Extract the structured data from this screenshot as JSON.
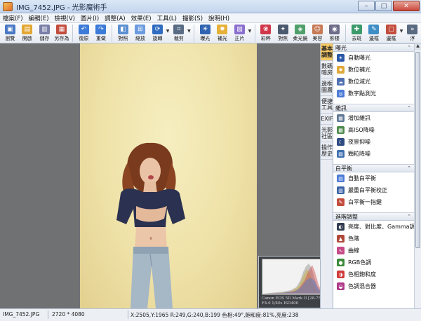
{
  "window": {
    "title": "IMG_7452.JPG - 光影魔術手",
    "min": "–",
    "max": "□",
    "close": "✕"
  },
  "menu": [
    "檔案(F)",
    "編輯(E)",
    "檢視(V)",
    "圖片(I)",
    "調整(A)",
    "效果(E)",
    "工具(L)",
    "撮影(S)",
    "說明(H)"
  ],
  "toolbar": [
    {
      "name": "browse",
      "label": "瀏覽",
      "color": "#4a79c4",
      "glyph": "▣"
    },
    {
      "name": "open",
      "label": "開啟",
      "color": "#e3a734",
      "glyph": "▤"
    },
    {
      "name": "save",
      "label": "儲存",
      "color": "#7a7fa8",
      "glyph": "▥"
    },
    {
      "name": "save-as",
      "label": "另存為",
      "color": "#c24c3d",
      "glyph": "▦"
    },
    {
      "name": "undo",
      "label": "復原",
      "color": "#3d7bd8",
      "glyph": "↶"
    },
    {
      "name": "redo",
      "label": "重做",
      "color": "#3d7bd8",
      "glyph": "↷"
    },
    {
      "name": "compare",
      "label": "對照",
      "color": "#5a8fd0",
      "glyph": "◧"
    },
    {
      "name": "zoom",
      "label": "縮放",
      "color": "#6b9be0",
      "glyph": "⊞"
    },
    {
      "name": "rotate",
      "label": "旋轉",
      "color": "#2f6cc0",
      "glyph": "⟳"
    },
    {
      "name": "crop",
      "label": "裁剪",
      "color": "#596b85",
      "glyph": "⌗"
    },
    {
      "name": "exposure",
      "label": "曝光",
      "color": "#3063b0",
      "glyph": "☀"
    },
    {
      "name": "fill-light",
      "label": "補光",
      "color": "#e6b13a",
      "glyph": "✹"
    },
    {
      "name": "correction",
      "label": "正片",
      "color": "#8b6fcf",
      "glyph": "▨"
    },
    {
      "name": "color",
      "label": "彩粹",
      "color": "#d0384a",
      "glyph": "❀"
    },
    {
      "name": "focus",
      "label": "對焦",
      "color": "#4b5a6e",
      "glyph": "✦"
    },
    {
      "name": "soft",
      "label": "柔光鏡",
      "color": "#4fa06a",
      "glyph": "◈"
    },
    {
      "name": "portrait",
      "label": "美容",
      "color": "#c77a56",
      "glyph": "☺"
    },
    {
      "name": "film",
      "label": "影楼",
      "color": "#6d6d8a",
      "glyph": "◉"
    },
    {
      "name": "stamp",
      "label": "去斑",
      "color": "#3c9a6b",
      "glyph": "✚"
    },
    {
      "name": "frame-edge",
      "label": "邊框",
      "color": "#3f8fc6",
      "glyph": "✎"
    },
    {
      "name": "border",
      "label": "邊框",
      "color": "#c24c3d",
      "glyph": "▢"
    },
    {
      "name": "more",
      "label": "浮",
      "color": "#5a6a80",
      "glyph": "»"
    }
  ],
  "vtabs": [
    "基本調整",
    "數碼暗房",
    "邊框圖層",
    "便捷工具",
    "EXIF",
    "光影社區",
    "操作歷史"
  ],
  "panel": [
    {
      "title": "曝光",
      "items": [
        {
          "label": "自動曝光",
          "color": "#2a56a8",
          "glyph": "☀"
        },
        {
          "label": "數位補光",
          "color": "#e0a83a",
          "glyph": "✹"
        },
        {
          "label": "數位減光",
          "color": "#4f6fb3",
          "glyph": "☁"
        },
        {
          "label": "數字點測光",
          "color": "#4a7ad6",
          "glyph": "◎"
        }
      ]
    },
    {
      "title": "雜訊",
      "items": [
        {
          "label": "增加雜訊",
          "color": "#5f7896",
          "glyph": "▦"
        },
        {
          "label": "高ISO降噪",
          "color": "#4e8a4e",
          "glyph": "▩"
        },
        {
          "label": "夜景抑噪",
          "color": "#2f4b82",
          "glyph": "☾"
        },
        {
          "label": "顆粒降噪",
          "color": "#3f6fb0",
          "glyph": "▨"
        }
      ]
    },
    {
      "title": "白平衡",
      "items": [
        {
          "label": "自動白平衡",
          "color": "#4a7ad6",
          "glyph": "▤"
        },
        {
          "label": "嚴重白平衡校正",
          "color": "#3a62a6",
          "glyph": "▥"
        },
        {
          "label": "白平衡一指鍵",
          "color": "#c24c3d",
          "glyph": "✎"
        }
      ]
    },
    {
      "title": "進階調整",
      "items": [
        {
          "label": "亮度、對比度、Gamma調整",
          "color": "#303b50",
          "glyph": "◐"
        },
        {
          "label": "色階",
          "color": "#b0483a",
          "glyph": "▲"
        },
        {
          "label": "曲線",
          "color": "#c44a86",
          "glyph": "∿"
        },
        {
          "label": "RGB色調",
          "color": "#3a8a3a",
          "glyph": "●"
        },
        {
          "label": "色相飽和度",
          "color": "#d03a3a",
          "glyph": "◑"
        },
        {
          "label": "色調混合器",
          "color": "#b03a8a",
          "glyph": "◒"
        }
      ]
    }
  ],
  "histogram": {
    "close": "×",
    "exif_line1": "Canon EOS 5D Mark II [28-75mm]",
    "exif_line2": "F4.0 1/40s ISO400"
  },
  "status": {
    "filename": "IMG_7452.JPG",
    "dimensions": "2720 * 4080",
    "pixel_info": "X:2505,Y:1965 R:249,G:240,B:199 色相:49°,飽和度:81%,亮度:238"
  },
  "colors": {
    "accent": "#f5c964",
    "photo_bg": "#f0e4ab",
    "canvas": "#6f7173"
  }
}
